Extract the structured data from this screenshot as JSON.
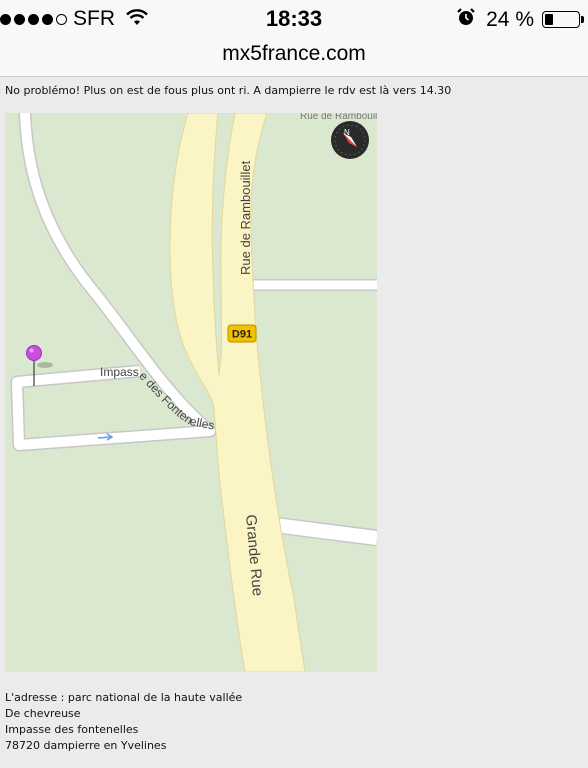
{
  "status_bar": {
    "carrier": "SFR",
    "time": "18:33",
    "battery_percent_text": "24 %",
    "battery_level": 0.24,
    "signal_bars_filled": 4,
    "signal_bars_total": 5,
    "icons": [
      "wifi-icon",
      "alarm-icon",
      "battery-icon"
    ]
  },
  "browser": {
    "url": "mx5france.com"
  },
  "post": {
    "message": "No problémo! Plus on est de fous plus ont ri. A dampierre le rdv est là vers 14.30"
  },
  "map": {
    "labels": {
      "street_top": "Rue de Rambouillet",
      "route_badge": "D91",
      "impasse": "Impasse des Fontenelles",
      "grande_rue": "Grande Rue",
      "top_partial": "Rue de Rambouillet"
    },
    "compass_letter": "N",
    "colors": {
      "land": "#d9e8cf",
      "road_major": "#fbf4c4",
      "road_minor": "#ffffff",
      "badge": "#f2c200",
      "pin": "#c94fdc"
    }
  },
  "address": {
    "lines": [
      "L'adresse : parc national de la haute vallée",
      "De chevreuse",
      "Impasse des fontenelles",
      "78720 dampierre en Yvelines"
    ]
  }
}
